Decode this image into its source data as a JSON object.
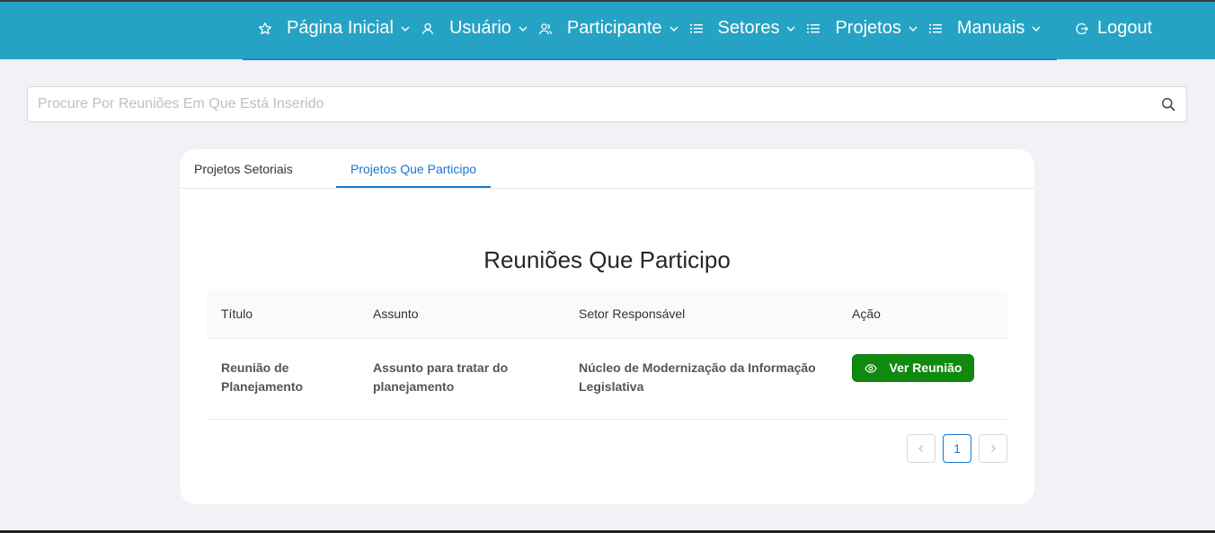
{
  "nav": {
    "items": [
      {
        "label": "Página Inicial",
        "icon": "star-icon"
      },
      {
        "label": "Usuário",
        "icon": "user-icon"
      },
      {
        "label": "Participante",
        "icon": "users-icon"
      },
      {
        "label": "Setores",
        "icon": "list-icon"
      },
      {
        "label": "Projetos",
        "icon": "list-icon"
      },
      {
        "label": "Manuais",
        "icon": "list-icon"
      }
    ],
    "logout_label": "Logout",
    "bg_color": "#26a3c4"
  },
  "search": {
    "placeholder": "Procure Por Reuniões Em Que Está Inserido",
    "value": ""
  },
  "tabs": [
    {
      "label": "Projetos Setoriais",
      "active": false
    },
    {
      "label": "Projetos Que Participo",
      "active": true
    }
  ],
  "section_title": "Reuniões Que Participo",
  "table": {
    "headers": [
      "Título",
      "Assunto",
      "Setor Responsável",
      "Ação"
    ],
    "rows": [
      {
        "titulo": "Reunião de Planejamento",
        "assunto": "Assunto para tratar do planejamento",
        "setor": "Núcleo de Modernização da Informação Legislativa",
        "acao": "Ver Reunião"
      }
    ]
  },
  "pagination": {
    "current": "1"
  },
  "colors": {
    "accent": "#1677d2",
    "action_button": "#0f8a0f"
  }
}
